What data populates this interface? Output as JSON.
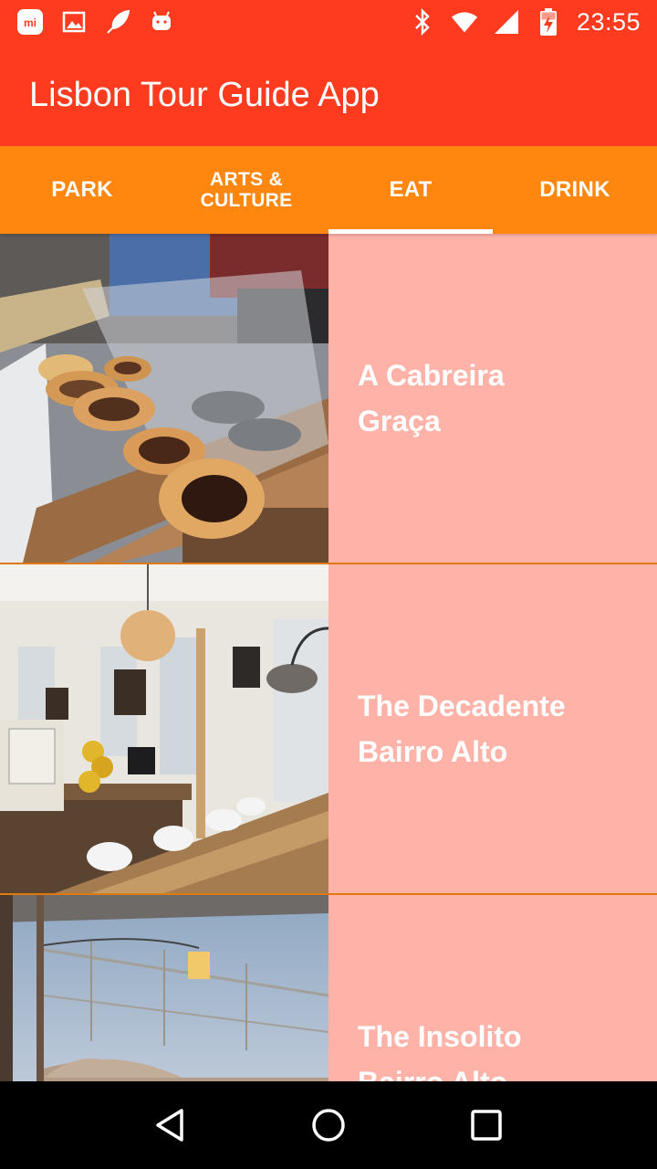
{
  "status_bar": {
    "time": "23:55",
    "left_icons": [
      "mi-icon",
      "image-icon",
      "feather-icon",
      "android-icon"
    ],
    "right_icons": [
      "bluetooth-icon",
      "wifi-icon",
      "signal-icon",
      "battery-charging-icon"
    ]
  },
  "app_bar": {
    "title": "Lisbon Tour Guide App",
    "color": "#FF3B1F"
  },
  "tabs": {
    "color": "#FF870F",
    "selected": "EAT",
    "items": [
      {
        "label": "PARK"
      },
      {
        "label": "ARTS & CULTURE"
      },
      {
        "label": "EAT"
      },
      {
        "label": "DRINK"
      }
    ]
  },
  "places": [
    {
      "name_line1": "A Cabreira",
      "name_line2": "Graça",
      "image": "pastel-de-nata-photo"
    },
    {
      "name_line1": "The Decadente",
      "name_line2": "Bairro Alto",
      "image": "restaurant-interior-photo"
    },
    {
      "name_line1": "The Insolito",
      "name_line2": "Bairro Alto",
      "image": "terrace-view-photo"
    }
  ],
  "list_background": "#FFB3A8",
  "nav_bar": {
    "buttons": [
      "back-icon",
      "home-icon",
      "recents-icon"
    ]
  }
}
